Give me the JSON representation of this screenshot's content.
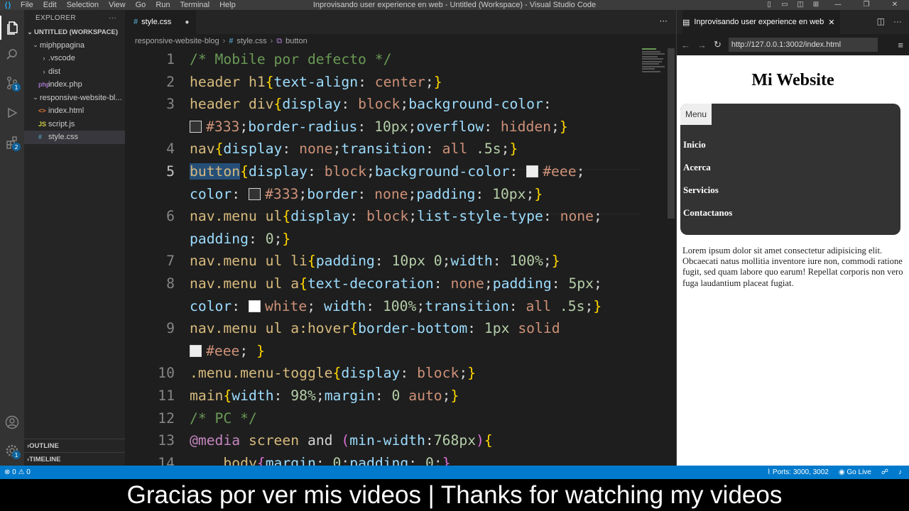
{
  "titlebar": {
    "menu": [
      "File",
      "Edit",
      "Selection",
      "View",
      "Go",
      "Run",
      "Terminal",
      "Help"
    ],
    "window_title": "Inprovisando user experience en web - Untitled (Workspace) - Visual Studio Code"
  },
  "sidebar": {
    "header": "EXPLORER",
    "workspace": "UNTITLED (WORKSPACE)",
    "tree": [
      {
        "label": "miphppagina",
        "type": "folder-open",
        "indent": 1
      },
      {
        "label": ".vscode",
        "type": "folder",
        "indent": 2
      },
      {
        "label": "dist",
        "type": "folder",
        "indent": 2
      },
      {
        "label": "index.php",
        "type": "php",
        "indent": 2
      },
      {
        "label": "responsive-website-bl...",
        "type": "folder-open",
        "indent": 1
      },
      {
        "label": "index.html",
        "type": "html",
        "indent": 2
      },
      {
        "label": "script.js",
        "type": "js",
        "indent": 2
      },
      {
        "label": "style.css",
        "type": "css",
        "indent": 2
      }
    ],
    "outline": "OUTLINE",
    "timeline": "TIMELINE",
    "activity_badges": {
      "scm": "1",
      "extensions": "2",
      "settings": "1"
    }
  },
  "editor": {
    "tab": "style.css",
    "breadcrumb": [
      "responsive-website-blog",
      "style.css",
      "button"
    ]
  },
  "browser": {
    "tab_title": "Inprovisando user experience en web",
    "url": "http://127.0.0.1:3002/index.html",
    "site_title": "Mi Website",
    "menu_button": "Menu",
    "nav_links": [
      "Inicio",
      "Acerca",
      "Servicios",
      "Contactanos"
    ],
    "body_text": "Lorem ipsum dolor sit amet consectetur adipisicing elit. Obcaecati natus mollitia inventore iure non, commodi ratione fugit, sed quam labore quo earum! Repellat corporis non vero fuga laudantium placeat fugiat."
  },
  "status": {
    "problems": "⊗ 0 ⚠ 0",
    "ports": "Ports: 3000, 3002",
    "golive": "Go Live"
  },
  "caption": "Gracias por ver mis videos | Thanks for watching my videos",
  "colors": {
    "accent": "#007acc",
    "editor_bg": "#1e1e1e",
    "sidebar_bg": "#252526",
    "nav_bg": "#333333"
  }
}
